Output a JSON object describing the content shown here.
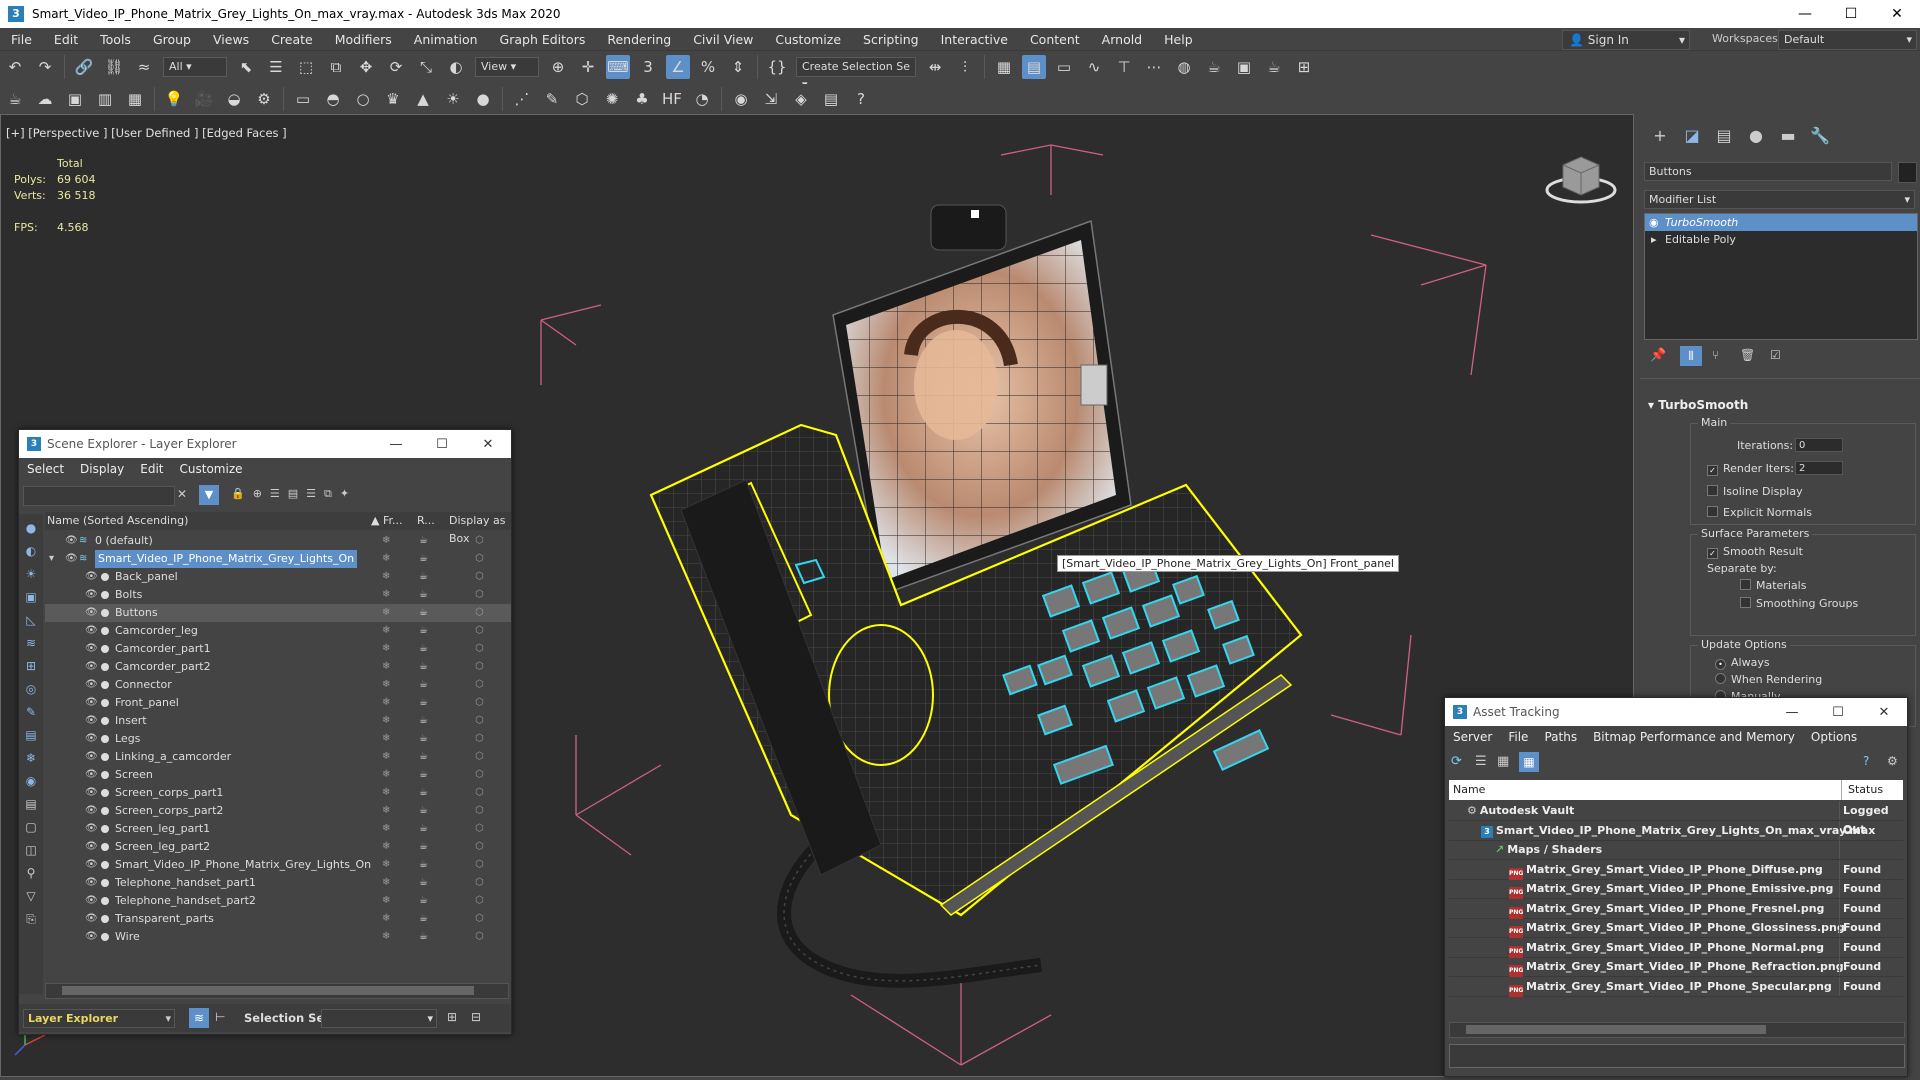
{
  "app": {
    "title": "Smart_Video_IP_Phone_Matrix_Grey_Lights_On_max_vray.max - Autodesk 3ds Max 2020",
    "icon_letter": "3",
    "window_controls": [
      "—",
      "☐",
      "✕"
    ]
  },
  "menu": [
    "File",
    "Edit",
    "Tools",
    "Group",
    "Views",
    "Create",
    "Modifiers",
    "Animation",
    "Graph Editors",
    "Rendering",
    "Civil View",
    "Customize",
    "Scripting",
    "Interactive",
    "Content",
    "Arnold",
    "Help"
  ],
  "signin": "Sign In",
  "workspace": {
    "label": "Workspaces:",
    "value": "Default"
  },
  "toolbar": {
    "filter": "All",
    "view": "View",
    "selection_set": "Create Selection Se"
  },
  "viewport": {
    "label": "[+] [Perspective ] [User Defined ] [Edged Faces ]",
    "stats_header": "Total",
    "polys_label": "Polys:",
    "polys": "69 604",
    "verts_label": "Verts:",
    "verts": "36 518",
    "fps_label": "FPS:",
    "fps": "4.568",
    "tooltip": "[Smart_Video_IP_Phone_Matrix_Grey_Lights_On] Front_panel"
  },
  "cmdpanel": {
    "name_field": "Buttons",
    "modifier_list": "Modifier List",
    "stack": [
      {
        "label": "TurboSmooth",
        "selected": true
      },
      {
        "label": "Editable Poly",
        "selected": false
      }
    ],
    "rollout": "TurboSmooth",
    "main": "Main",
    "iterations_label": "Iterations:",
    "iterations": "0",
    "render_iters_label": "Render Iters:",
    "render_iters": "2",
    "isoline": "Isoline Display",
    "explicit_normals": "Explicit Normals",
    "surface_params": "Surface Parameters",
    "smooth_result": "Smooth Result",
    "separate_by": "Separate by:",
    "materials": "Materials",
    "smoothing_groups": "Smoothing Groups",
    "update_options": "Update Options",
    "always": "Always",
    "when_rendering": "When Rendering",
    "manually": "Manually"
  },
  "scene_explorer": {
    "title": "Scene Explorer - Layer Explorer",
    "menu": [
      "Select",
      "Display",
      "Edit",
      "Customize"
    ],
    "col_name": "Name (Sorted Ascending)",
    "col_fr": "▲ Fr...",
    "col_r": "R...",
    "col_box": "Display as Box",
    "layer_default": "0 (default)",
    "layer_main": "Smart_Video_IP_Phone_Matrix_Grey_Lights_On",
    "items": [
      "Back_panel",
      "Bolts",
      "Buttons",
      "Camcorder_leg",
      "Camcorder_part1",
      "Camcorder_part2",
      "Connector",
      "Front_panel",
      "Insert",
      "Legs",
      "Linking_a_camcorder",
      "Screen",
      "Screen_corps_part1",
      "Screen_corps_part2",
      "Screen_leg_part1",
      "Screen_leg_part2",
      "Smart_Video_IP_Phone_Matrix_Grey_Lights_On",
      "Telephone_handset_part1",
      "Telephone_handset_part2",
      "Transparent_parts",
      "Wire"
    ],
    "footer_explorer": "Layer Explorer",
    "footer_selset": "Selection Set:"
  },
  "asset_tracking": {
    "title": "Asset Tracking",
    "menu": [
      "Server",
      "File",
      "Paths",
      "Bitmap Performance and Memory",
      "Options"
    ],
    "col_name": "Name",
    "col_status": "Status",
    "rows": [
      {
        "name": "Autodesk Vault",
        "status": "Logged Out",
        "indent": 1,
        "icon": "vault"
      },
      {
        "name": "Smart_Video_IP_Phone_Matrix_Grey_Lights_On_max_vray.max",
        "status": "Ok",
        "indent": 2,
        "icon": "max"
      },
      {
        "name": "Maps / Shaders",
        "status": "",
        "indent": 3,
        "icon": "maps"
      },
      {
        "name": "Matrix_Grey_Smart_Video_IP_Phone_Diffuse.png",
        "status": "Found",
        "indent": 4,
        "icon": "png"
      },
      {
        "name": "Matrix_Grey_Smart_Video_IP_Phone_Emissive.png",
        "status": "Found",
        "indent": 4,
        "icon": "png"
      },
      {
        "name": "Matrix_Grey_Smart_Video_IP_Phone_Fresnel.png",
        "status": "Found",
        "indent": 4,
        "icon": "png"
      },
      {
        "name": "Matrix_Grey_Smart_Video_IP_Phone_Glossiness.png",
        "status": "Found",
        "indent": 4,
        "icon": "png"
      },
      {
        "name": "Matrix_Grey_Smart_Video_IP_Phone_Normal.png",
        "status": "Found",
        "indent": 4,
        "icon": "png"
      },
      {
        "name": "Matrix_Grey_Smart_Video_IP_Phone_Refraction.png",
        "status": "Found",
        "indent": 4,
        "icon": "png"
      },
      {
        "name": "Matrix_Grey_Smart_Video_IP_Phone_Specular.png",
        "status": "Found",
        "indent": 4,
        "icon": "png"
      }
    ]
  },
  "colors": {
    "selection": "#5d8fc8",
    "wireframe_yellow": "#ffff00",
    "wireframe_cyan": "#33d6f0",
    "gizmo_pink": "#d06080"
  }
}
